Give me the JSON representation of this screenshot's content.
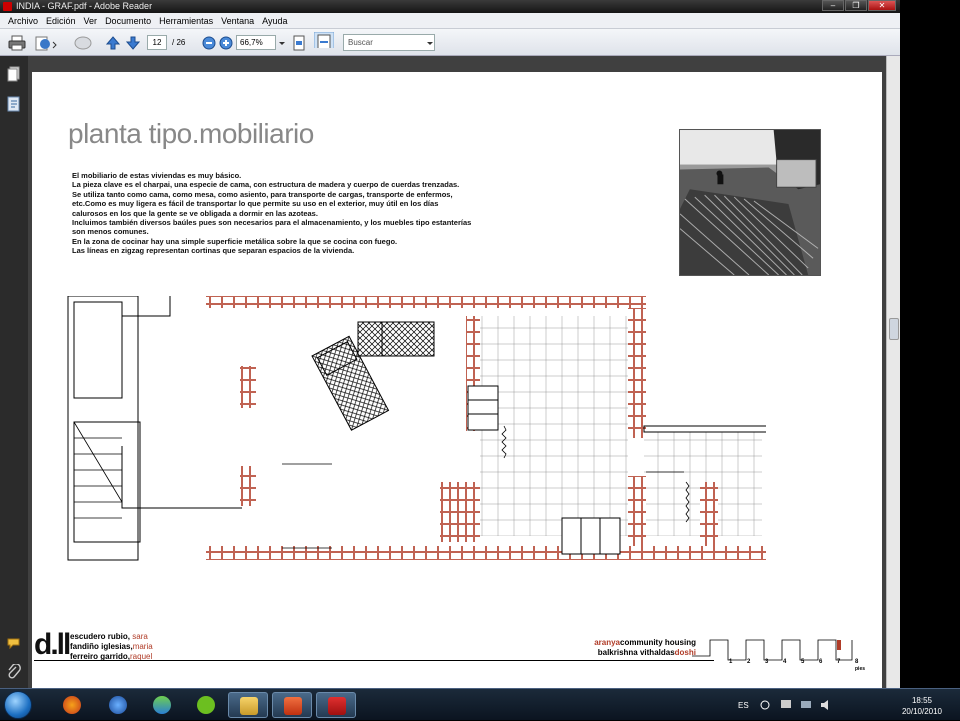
{
  "window": {
    "title": "INDIA - GRAF.pdf - Adobe Reader",
    "controls": [
      "–",
      "❐",
      "✕"
    ]
  },
  "menu": [
    "Archivo",
    "Edición",
    "Ver",
    "Documento",
    "Herramientas",
    "Ventana",
    "Ayuda"
  ],
  "toolbar": {
    "page_current": "12",
    "page_total": "/ 26",
    "zoom": "66,7%",
    "search_placeholder": "Buscar"
  },
  "document": {
    "title": "planta tipo.mobiliario",
    "paragraphs": [
      "El mobiliario de estas viviendas es muy básico.",
      "La pieza clave es el charpai, una especie de cama, con estructura de madera y cuerpo de cuerdas trenzadas.",
      "Se utiliza tanto como cama, como mesa, como asiento, para transporte de cargas, transporte de enfermos,",
      "etc.Como es muy ligera es fácil de transportar lo que permite su uso en el exterior, muy útil en los días",
      "calurosos en los que la gente se ve obligada a dormir en las azoteas.",
      "Incluimos también diversos baúles pues son necesarios para el almacenamiento, y los muebles tipo estanterías",
      "son menos comunes.",
      "En la zona de cocinar hay una simple superficie metálica sobre la que se cocina con fuego.",
      "Las líneas en zigzag representan cortinas que separan espacios de la vivienda."
    ],
    "footer": {
      "logo": "d.ll",
      "authors": [
        {
          "surname": "escudero rubio,",
          "name": "sara"
        },
        {
          "surname": "fandiño iglesias,",
          "name": "maria"
        },
        {
          "surname": "ferreiro garrido,",
          "name": "raquel"
        }
      ],
      "project_red": "aranya",
      "project_black": "community housing",
      "architect_black": "balkrishna vithaldas",
      "architect_red": "doshi",
      "scale_labels": [
        "1",
        "2",
        "3",
        "4",
        "5",
        "6",
        "7",
        "8"
      ],
      "scale_unit": "pies"
    }
  },
  "taskbar": {
    "language": "ES",
    "time": "18:55",
    "date": "20/10/2010"
  },
  "colors": {
    "brick": "#b03c28",
    "titlebar": "#1a1a1a",
    "doc_bg": "#404040"
  }
}
